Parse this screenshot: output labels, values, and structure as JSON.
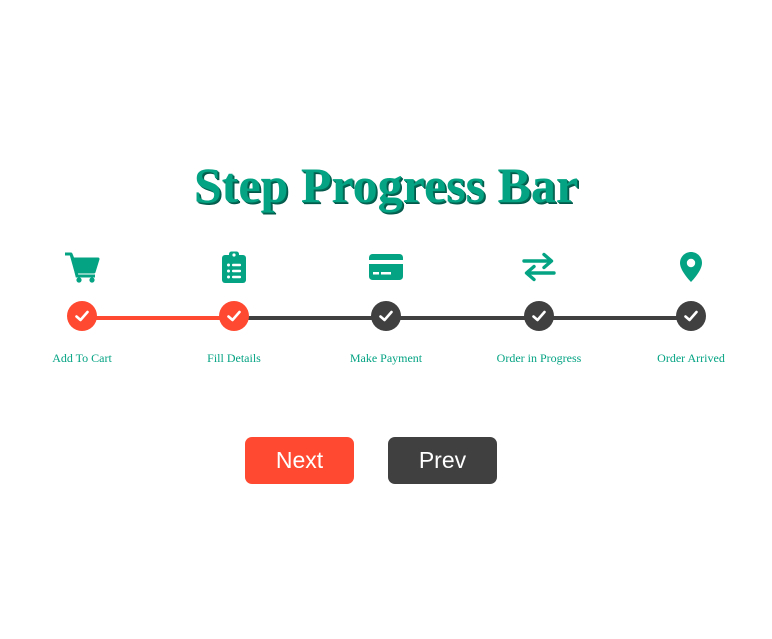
{
  "title": "Step Progress Bar",
  "colors": {
    "accent": "#04a383",
    "active": "#ff4a31",
    "inactive": "#404040"
  },
  "steps": [
    {
      "label": "Add To Cart",
      "icon": "cart-icon",
      "completed": true
    },
    {
      "label": "Fill Details",
      "icon": "clipboard-icon",
      "completed": true
    },
    {
      "label": "Make Payment",
      "icon": "credit-card-icon",
      "completed": false
    },
    {
      "label": "Order in Progress",
      "icon": "exchange-icon",
      "completed": false
    },
    {
      "label": "Order Arrived",
      "icon": "location-pin-icon",
      "completed": false
    }
  ],
  "buttons": {
    "next_label": "Next",
    "prev_label": "Prev"
  }
}
